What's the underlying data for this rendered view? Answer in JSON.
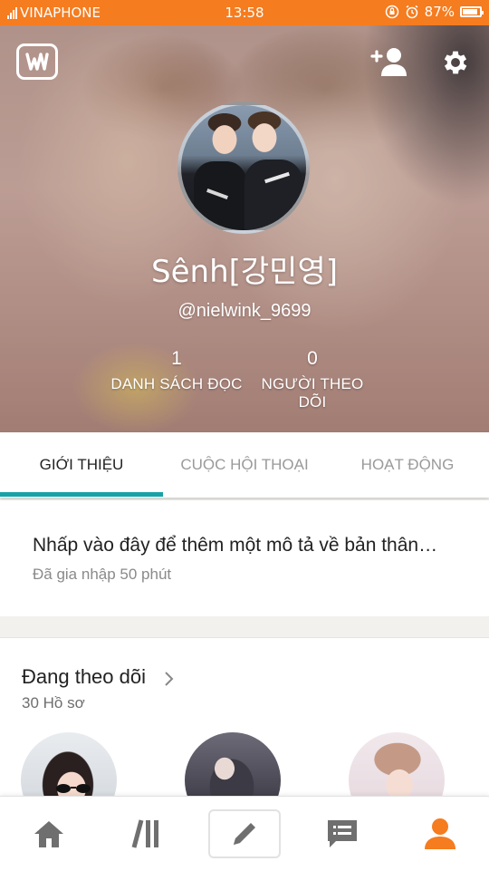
{
  "status_bar": {
    "carrier": "VINAPHONE",
    "time": "13:58",
    "battery": "87%",
    "battery_level": 0.87
  },
  "header": {
    "app_logo_icon": "wattpad-logo-icon",
    "add_friend_icon": "add-user-icon",
    "settings_icon": "gear-icon"
  },
  "profile": {
    "display_name": "Sênh[강민영]",
    "username": "@nielwink_9699",
    "stats": {
      "reading_lists": {
        "value": "1",
        "label": "DANH SÁCH ĐỌC"
      },
      "followers": {
        "value": "0",
        "label": "NGƯỜI THEO DÕI"
      }
    }
  },
  "tabs": [
    {
      "label": "GIỚI THIỆU",
      "active": true
    },
    {
      "label": "CUỘC HỘI THOẠI",
      "active": false
    },
    {
      "label": "HOẠT ĐỘNG",
      "active": false
    }
  ],
  "about": {
    "description_prompt": "Nhấp vào đây để thêm một mô tả về bản thân…",
    "joined": "Đã gia nhập 50 phút"
  },
  "following": {
    "title": "Đang theo dõi",
    "count": "30 Hồ sơ"
  },
  "bottom_nav": [
    {
      "icon": "home-icon",
      "active": false
    },
    {
      "icon": "library-icon",
      "active": false
    },
    {
      "icon": "pencil-icon",
      "active": false
    },
    {
      "icon": "messages-icon",
      "active": false
    },
    {
      "icon": "profile-icon",
      "active": true
    }
  ],
  "colors": {
    "status_bar": "#f57c1f",
    "accent_teal": "#17a2a6",
    "active_nav": "#f57c1f",
    "inactive_nav": "#6f6f6f"
  }
}
